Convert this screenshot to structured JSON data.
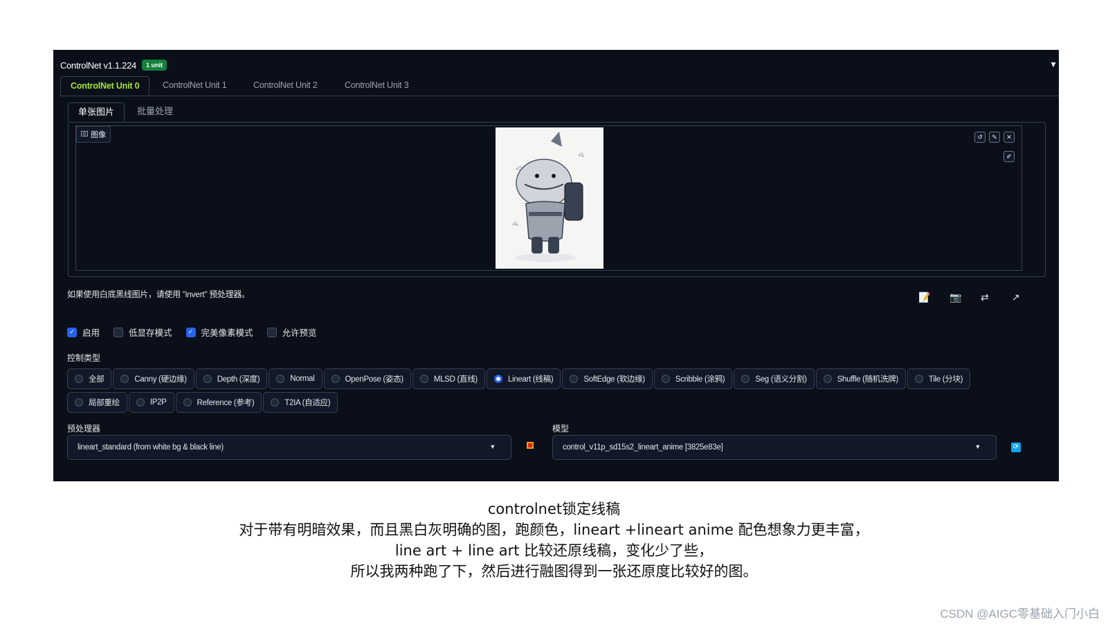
{
  "app": {
    "title": "ControlNet v1.1.224",
    "badge": "1 unit"
  },
  "unit_tabs": [
    {
      "label": "ControlNet Unit 0",
      "active": true
    },
    {
      "label": "ControlNet Unit 1",
      "active": false
    },
    {
      "label": "ControlNet Unit 2",
      "active": false
    },
    {
      "label": "ControlNet Unit 3",
      "active": false
    }
  ],
  "sub_tabs": [
    {
      "label": "单张图片",
      "active": true
    },
    {
      "label": "批量处理",
      "active": false
    }
  ],
  "image_area": {
    "label": "图像",
    "image_icon": "image-icon"
  },
  "hint": "如果使用白底黑线图片，请使用 \"invert\" 预处理器。",
  "options": [
    {
      "label": "启用",
      "checked": true
    },
    {
      "label": "低显存模式",
      "checked": false
    },
    {
      "label": "完美像素模式",
      "checked": true
    },
    {
      "label": "允许预览",
      "checked": false
    }
  ],
  "control_type_label": "控制类型",
  "control_types_row1": [
    {
      "label": "全部",
      "selected": false
    },
    {
      "label": "Canny (硬边缘)",
      "selected": false
    },
    {
      "label": "Depth (深度)",
      "selected": false
    },
    {
      "label": "Normal",
      "selected": false
    },
    {
      "label": "OpenPose (姿态)",
      "selected": false
    },
    {
      "label": "MLSD (直线)",
      "selected": false
    },
    {
      "label": "Lineart (线稿)",
      "selected": true
    },
    {
      "label": "SoftEdge (软边缘)",
      "selected": false
    },
    {
      "label": "Scribble (涂鸦)",
      "selected": false
    },
    {
      "label": "Seg (语义分割)",
      "selected": false
    },
    {
      "label": "Shuffle (随机洗牌)",
      "selected": false
    },
    {
      "label": "Tile (分块)",
      "selected": false
    }
  ],
  "control_types_row2": [
    {
      "label": "局部重绘",
      "selected": false
    },
    {
      "label": "IP2P",
      "selected": false
    },
    {
      "label": "Reference (参考)",
      "selected": false
    },
    {
      "label": "T2IA (自适应)",
      "selected": false
    }
  ],
  "preprocessor": {
    "label": "预处理器",
    "value": "lineart_standard (from white bg & black line)"
  },
  "model": {
    "label": "模型",
    "value": "control_v11p_sd15s2_lineart_anime [3825e83e]"
  },
  "caption": [
    "controlnet锁定线稿",
    "对于带有明暗效果，而且黑白灰明确的图，跑颜色，lineart +lineart anime 配色想象力更丰富，",
    "line art + line art 比较还原线稿，变化少了些，",
    "所以我两种跑了下，然后进行融图得到一张还原度比较好的图。"
  ],
  "watermark": "CSDN @AIGC零基础入门小白",
  "colors": {
    "accent": "#a3e635",
    "badge": "#15803d",
    "selected": "#2563eb",
    "panel_bg": "#0b0f19"
  }
}
